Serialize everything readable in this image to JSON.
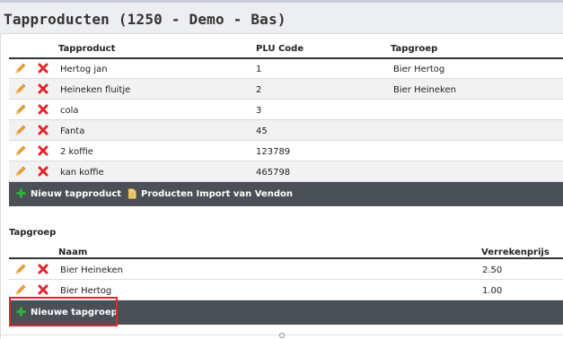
{
  "header": {
    "title": "Tapproducten (1250 - Demo - Bas)"
  },
  "products": {
    "columns": {
      "product": "Tapproduct",
      "plu": "PLU Code",
      "group": "Tapgroep"
    },
    "rows": [
      {
        "name": "Hertog jan",
        "plu": "1",
        "group": "Bier Hertog"
      },
      {
        "name": "Heineken fluitje",
        "plu": "2",
        "group": "Bier Heineken"
      },
      {
        "name": "cola",
        "plu": "3",
        "group": ""
      },
      {
        "name": "Fanta",
        "plu": "45",
        "group": ""
      },
      {
        "name": "2 koffie",
        "plu": "123789",
        "group": ""
      },
      {
        "name": "kan koffie",
        "plu": "465798",
        "group": ""
      }
    ],
    "actions": {
      "new": "Nieuw tapproduct",
      "import": "Producten Import van Vendon"
    }
  },
  "groups": {
    "section_title": "Tapgroep",
    "columns": {
      "name": "Naam",
      "price": "Verrekenprijs"
    },
    "rows": [
      {
        "name": "Bier Heineken",
        "price": "2.50"
      },
      {
        "name": "Bier Hertog",
        "price": "1.00"
      }
    ],
    "actions": {
      "new": "Nieuwe tapgroep"
    }
  },
  "icons": {
    "edit": "pencil-icon",
    "delete": "delete-x-icon",
    "add": "plus-icon",
    "import": "document-import-icon"
  },
  "colors": {
    "footer_bg": "#4a5056",
    "delete_red": "#e0262b",
    "add_green": "#2fae3a",
    "edit_orange": "#f0a030",
    "highlight": "#e0262b"
  }
}
